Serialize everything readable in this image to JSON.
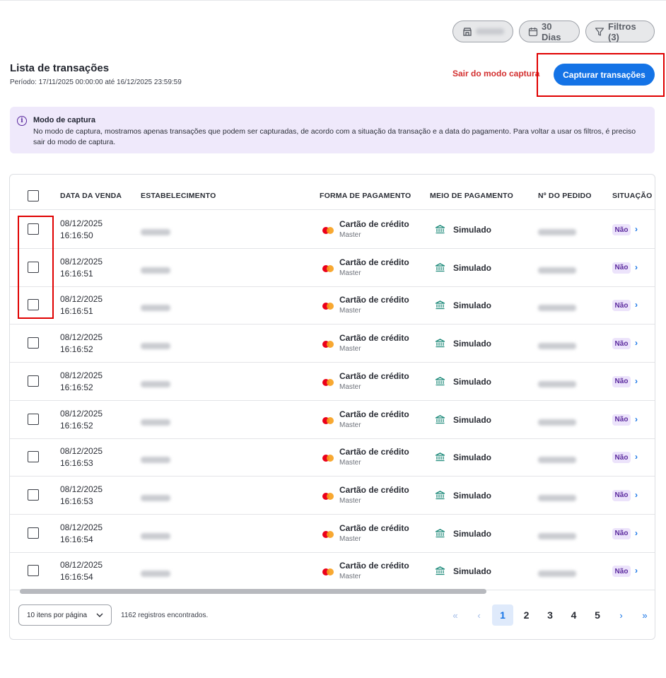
{
  "filters": {
    "store_label": "",
    "days_label": "30 Dias",
    "filters_label": "Filtros (3)"
  },
  "header": {
    "title": "Lista de transações",
    "period": "Período: 17/11/2025 00:00:00 até 16/12/2025 23:59:59",
    "exit_capture": "Sair do modo captura",
    "capture_button": "Capturar transações"
  },
  "banner": {
    "icon": "info-icon",
    "title": "Modo de captura",
    "text": "No modo de captura, mostramos apenas transações que podem ser capturadas, de acordo com a situação da transação e a data do pagamento. Para voltar a usar os filtros, é preciso sair do modo de captura."
  },
  "table": {
    "columns": [
      "DATA DA VENDA",
      "ESTABELECIMENTO",
      "FORMA DE PAGAMENTO",
      "MEIO DE PAGAMENTO",
      "Nº DO PEDIDO",
      "SITUAÇÃO"
    ],
    "rows": [
      {
        "date": "08/12/2025",
        "time": "16:16:50",
        "payment": "Cartão de crédito",
        "brand": "Master",
        "method": "Simulado",
        "status": "Não"
      },
      {
        "date": "08/12/2025",
        "time": "16:16:51",
        "payment": "Cartão de crédito",
        "brand": "Master",
        "method": "Simulado",
        "status": "Não"
      },
      {
        "date": "08/12/2025",
        "time": "16:16:51",
        "payment": "Cartão de crédito",
        "brand": "Master",
        "method": "Simulado",
        "status": "Não"
      },
      {
        "date": "08/12/2025",
        "time": "16:16:52",
        "payment": "Cartão de crédito",
        "brand": "Master",
        "method": "Simulado",
        "status": "Não"
      },
      {
        "date": "08/12/2025",
        "time": "16:16:52",
        "payment": "Cartão de crédito",
        "brand": "Master",
        "method": "Simulado",
        "status": "Não"
      },
      {
        "date": "08/12/2025",
        "time": "16:16:52",
        "payment": "Cartão de crédito",
        "brand": "Master",
        "method": "Simulado",
        "status": "Não"
      },
      {
        "date": "08/12/2025",
        "time": "16:16:53",
        "payment": "Cartão de crédito",
        "brand": "Master",
        "method": "Simulado",
        "status": "Não"
      },
      {
        "date": "08/12/2025",
        "time": "16:16:53",
        "payment": "Cartão de crédito",
        "brand": "Master",
        "method": "Simulado",
        "status": "Não"
      },
      {
        "date": "08/12/2025",
        "time": "16:16:54",
        "payment": "Cartão de crédito",
        "brand": "Master",
        "method": "Simulado",
        "status": "Não"
      },
      {
        "date": "08/12/2025",
        "time": "16:16:54",
        "payment": "Cartão de crédito",
        "brand": "Master",
        "method": "Simulado",
        "status": "Não"
      }
    ]
  },
  "footer": {
    "per_page": "10 itens por página",
    "found": "1162 registros encontrados.",
    "pages": [
      "1",
      "2",
      "3",
      "4",
      "5"
    ],
    "current_page": "1",
    "first_icon": "«",
    "prev_icon": "‹",
    "next_icon": "›",
    "last_icon": "»"
  },
  "colors": {
    "accent": "#1473e6",
    "danger": "#d32f2f",
    "banner_bg": "#efe9fb",
    "badge_bg": "#ece3fb",
    "badge_text": "#5b2a9e",
    "highlight": "#e00000"
  }
}
